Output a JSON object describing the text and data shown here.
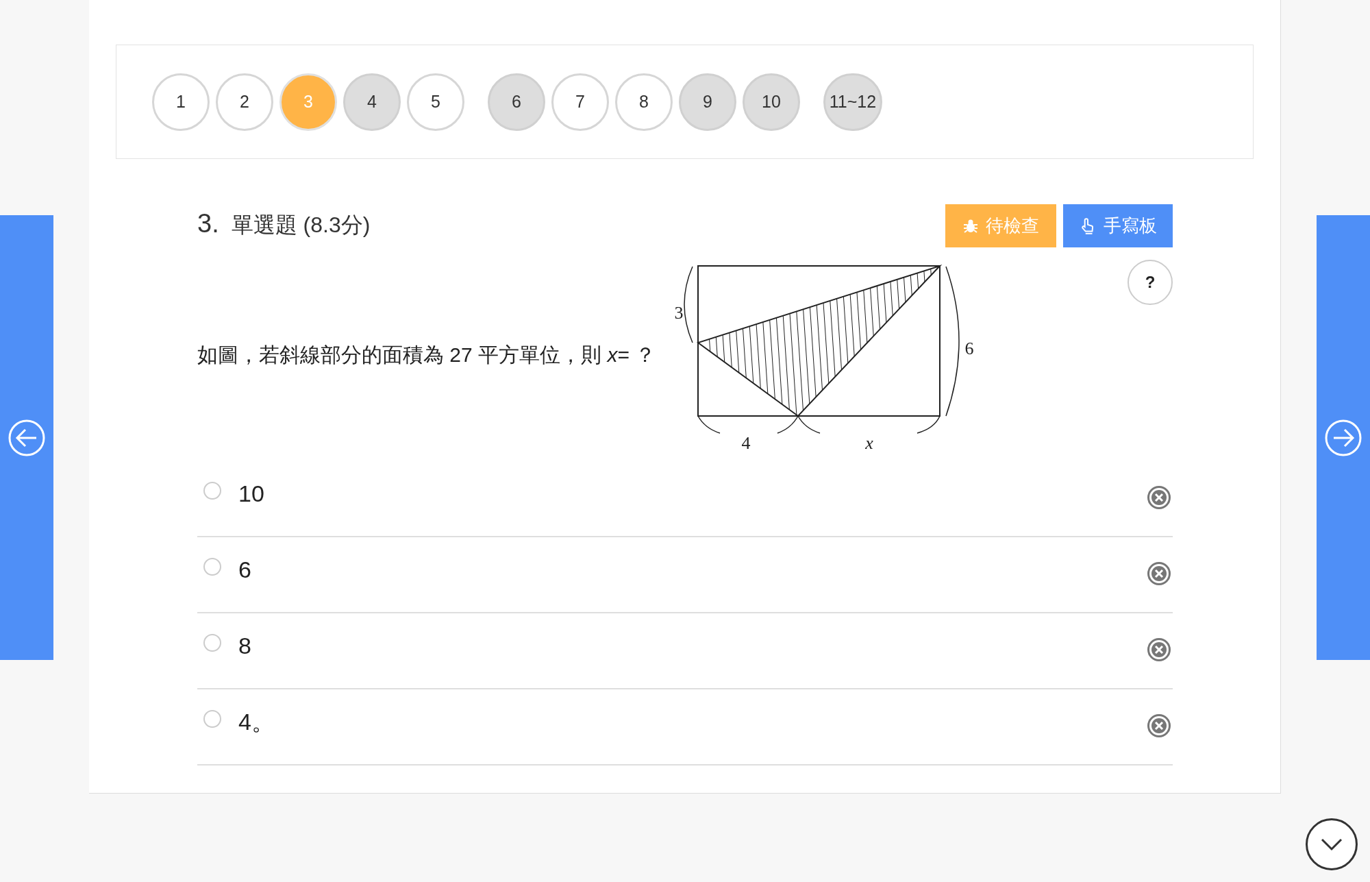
{
  "nav_groups": [
    [
      {
        "label": "1",
        "selected": false,
        "answered": false
      },
      {
        "label": "2",
        "selected": false,
        "answered": false
      },
      {
        "label": "3",
        "selected": true,
        "answered": false
      },
      {
        "label": "4",
        "selected": false,
        "answered": true
      },
      {
        "label": "5",
        "selected": false,
        "answered": false
      }
    ],
    [
      {
        "label": "6",
        "selected": false,
        "answered": true
      },
      {
        "label": "7",
        "selected": false,
        "answered": false
      },
      {
        "label": "8",
        "selected": false,
        "answered": false
      },
      {
        "label": "9",
        "selected": false,
        "answered": true
      },
      {
        "label": "10",
        "selected": false,
        "answered": true
      }
    ],
    [
      {
        "label": "11~12",
        "selected": false,
        "answered": true
      }
    ]
  ],
  "question": {
    "number": "3.",
    "type": "單選題",
    "score": "(8.3分)",
    "text": "如圖，若斜線部分的面積為 27 平方單位，則 *x*= ？",
    "figure_labels": [
      "3",
      "6",
      "4",
      "x"
    ]
  },
  "buttons": [
    {
      "kind": "review",
      "label": "待檢查"
    },
    {
      "kind": "handwriting",
      "label": "手寫板"
    }
  ],
  "help": "?",
  "options": [
    {
      "label": "10",
      "selected": false
    },
    {
      "label": "6",
      "selected": false
    },
    {
      "label": "8",
      "selected": false
    },
    {
      "label": "4。",
      "selected": false
    }
  ]
}
